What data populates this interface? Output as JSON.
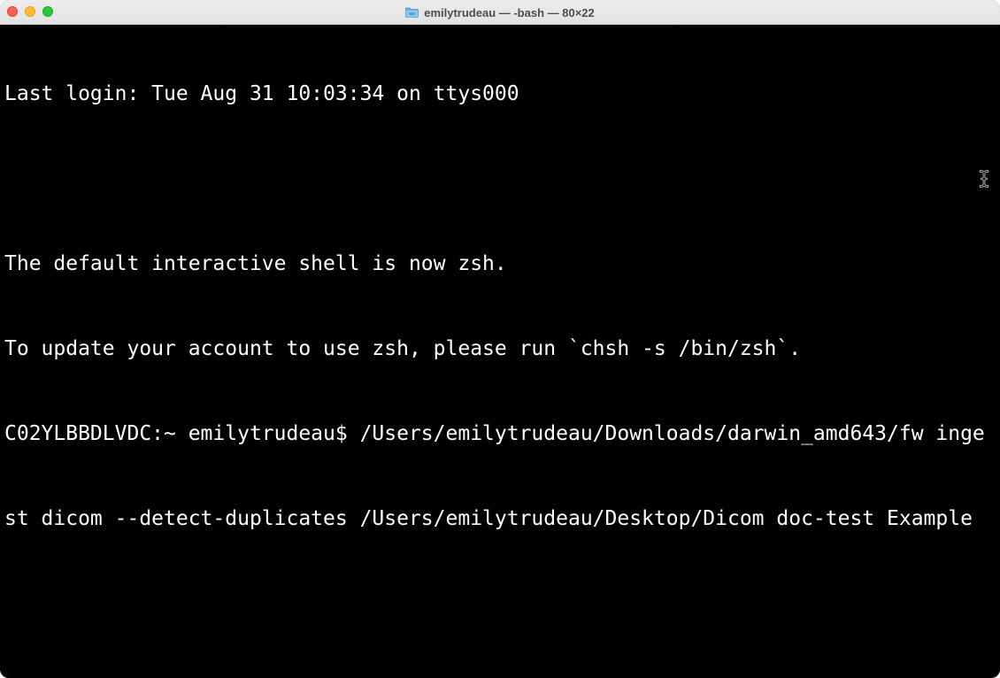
{
  "window": {
    "title": "emilytrudeau — -bash — 80×22",
    "title_icon": "folder-icon"
  },
  "terminal": {
    "lines": [
      "Last login: Tue Aug 31 10:03:34 on ttys000",
      "",
      "The default interactive shell is now zsh.",
      "To update your account to use zsh, please run `chsh -s /bin/zsh`.",
      "C02YLBBDLVDC:~ emilytrudeau$ /Users/emilytrudeau/Downloads/darwin_amd643/fw inge",
      "st dicom --detect-duplicates /Users/emilytrudeau/Desktop/Dicom doc-test Example"
    ],
    "cursor_icon": "ibeam-cursor-icon"
  },
  "colors": {
    "background": "#000000",
    "text": "#ffffff",
    "close": "#fe5f57",
    "minimize": "#febc2e",
    "zoom": "#28c840"
  }
}
